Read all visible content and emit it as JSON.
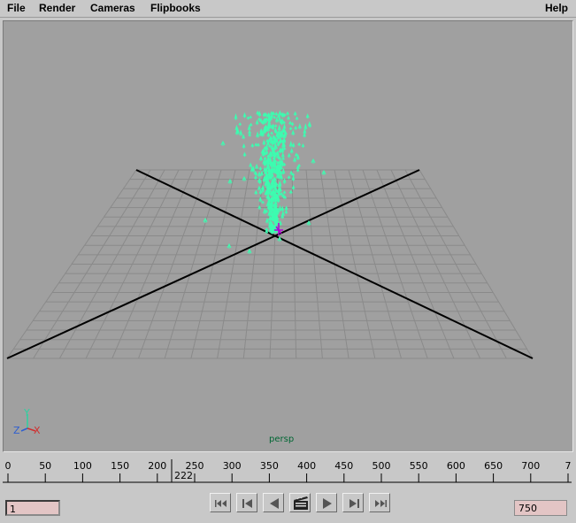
{
  "menubar": {
    "file": "File",
    "render": "Render",
    "cameras": "Cameras",
    "flipbooks": "Flipbooks",
    "help": "Help"
  },
  "viewport": {
    "camera_label": "persp",
    "axis_labels": {
      "y": "Y",
      "z": "Z",
      "x": "X"
    },
    "particle_color": "#3dfcb0",
    "grid_color": "#8a8a8a",
    "background": "#a0a0a0"
  },
  "timeline": {
    "ticks": [
      "0",
      "50",
      "100",
      "150",
      "200",
      "250",
      "300",
      "350",
      "400",
      "450",
      "500",
      "550",
      "600",
      "650",
      "700",
      "7"
    ],
    "current_frame": "222"
  },
  "range": {
    "start": "1",
    "end": "750"
  },
  "playback": {
    "buttons": [
      "go-to-start",
      "step-back-key",
      "step-back",
      "playblast",
      "play-forward",
      "step-forward-key",
      "go-to-end"
    ]
  }
}
